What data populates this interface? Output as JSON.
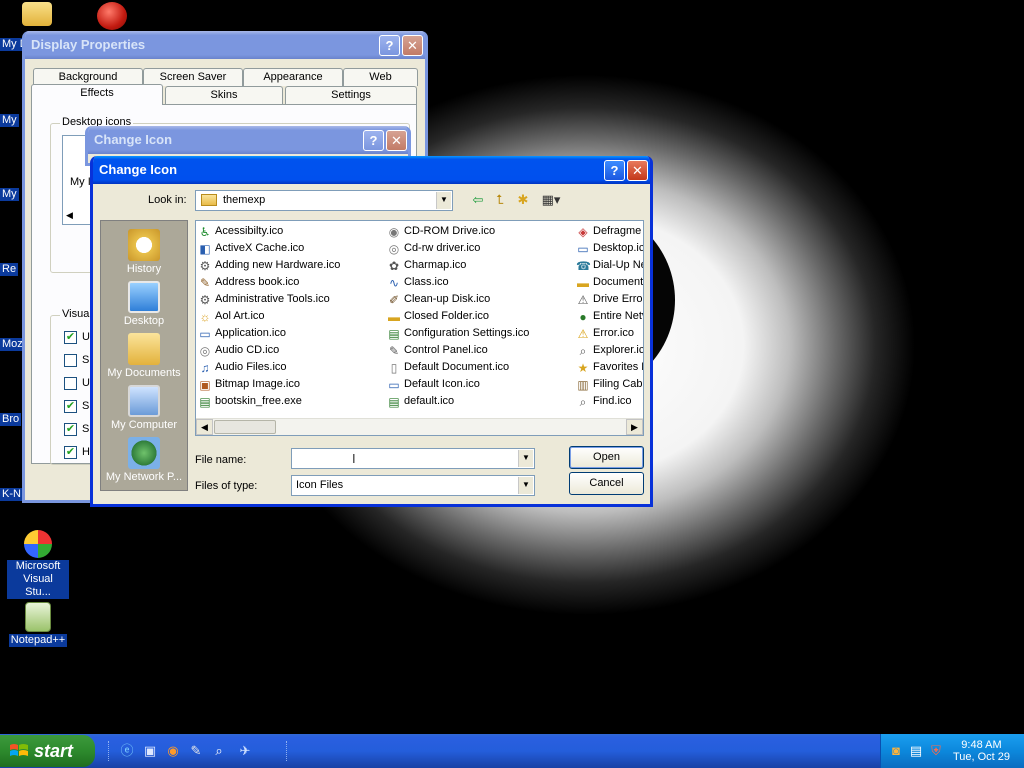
{
  "desktop": {
    "icons": [
      {
        "label": "Microsoft Visual Stu..."
      },
      {
        "label": "Notepad++"
      }
    ],
    "edge_labels": [
      "My D",
      "My",
      "My",
      "Re",
      "Moz",
      "Bro",
      "K-N"
    ]
  },
  "display_properties": {
    "title": "Display Properties",
    "tabs_back": [
      "Background",
      "Screen Saver",
      "Appearance",
      "Web"
    ],
    "tabs_front": [
      "Effects",
      "Skins",
      "Settings"
    ],
    "group_desktop_icons": "Desktop icons",
    "icon_label_fragment": "My I",
    "group_visual": "Visual",
    "checkbox_fragments": [
      "U",
      "S",
      "U",
      "S",
      "S",
      "H"
    ]
  },
  "change_icon_back": {
    "title": "Change Icon"
  },
  "dialog": {
    "title": "Change Icon",
    "look_in_label": "Look in:",
    "look_in_value": "themexp",
    "places": [
      "History",
      "Desktop",
      "My Documents",
      "My Computer",
      "My Network P..."
    ],
    "files_col1": [
      "Acessibilty.ico",
      "ActiveX Cache.ico",
      "Adding new Hardware.ico",
      "Address book.ico",
      "Administrative Tools.ico",
      "Aol Art.ico",
      "Application.ico",
      "Audio CD.ico",
      "Audio Files.ico",
      "Bitmap Image.ico",
      "bootskin_free.exe"
    ],
    "files_col2": [
      "CD-ROM Drive.ico",
      "Cd-rw driver.ico",
      "Charmap.ico",
      "Class.ico",
      "Clean-up Disk.ico",
      "Closed Folder.ico",
      "Configuration Settings.ico",
      "Control Panel.ico",
      "Default Document.ico",
      "Default Icon.ico",
      "default.ico"
    ],
    "files_col3": [
      "Defragme",
      "Desktop.ic",
      "Dial-Up Ne",
      "Document",
      "Drive Error",
      "Entire Netv",
      "Error.ico",
      "Explorer.ic",
      "Favorites F",
      "Filing Cabi",
      "Find.ico"
    ],
    "file_name_label": "File name:",
    "file_name_value": "",
    "files_of_type_label": "Files of type:",
    "files_of_type_value": "Icon Files",
    "open_label": "Open",
    "cancel_label": "Cancel"
  },
  "taskbar": {
    "start_label": "start",
    "time": "9:48 AM",
    "date": "Tue, Oct 29"
  },
  "colors": {
    "title_active": "#0054e3",
    "places_bar": "#aca899",
    "taskbar": "#245edb",
    "start_green": "#2d8a2d"
  }
}
